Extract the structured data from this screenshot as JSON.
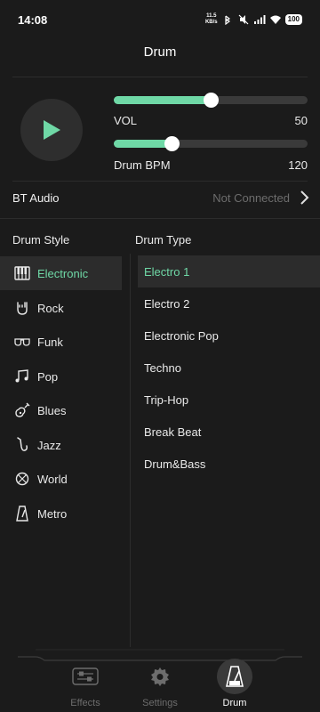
{
  "status": {
    "time": "14:08",
    "net_speed_value": "11.5",
    "net_speed_unit": "KB/s",
    "battery": "100"
  },
  "header": {
    "title": "Drum"
  },
  "player": {
    "vol_label": "VOL",
    "vol_value": "50",
    "vol_fraction": 0.5,
    "bpm_label": "Drum BPM",
    "bpm_value": "120",
    "bpm_fraction": 0.3
  },
  "bt": {
    "label": "BT Audio",
    "status": "Not Connected"
  },
  "drum_style": {
    "heading": "Drum Style",
    "items": [
      {
        "label": "Electronic",
        "icon": "keyboard-icon"
      },
      {
        "label": "Rock",
        "icon": "rock-hand-icon"
      },
      {
        "label": "Funk",
        "icon": "sunglasses-icon"
      },
      {
        "label": "Pop",
        "icon": "music-notes-icon"
      },
      {
        "label": "Blues",
        "icon": "guitar-icon"
      },
      {
        "label": "Jazz",
        "icon": "saxophone-icon"
      },
      {
        "label": "World",
        "icon": "globe-icon"
      },
      {
        "label": "Metro",
        "icon": "metronome-icon"
      }
    ],
    "selected": "Electronic"
  },
  "drum_type": {
    "heading": "Drum Type",
    "items": [
      "Electro 1",
      "Electro 2",
      "Electronic Pop",
      "Techno",
      "Trip-Hop",
      "Break Beat",
      "Drum&Bass"
    ],
    "selected": "Electro 1"
  },
  "nav": {
    "items": [
      {
        "label": "Effects",
        "icon": "effects-icon"
      },
      {
        "label": "Settings",
        "icon": "gear-icon"
      },
      {
        "label": "Drum",
        "icon": "metronome-icon"
      }
    ],
    "active": "Drum"
  },
  "colors": {
    "accent": "#6fd8a6",
    "background": "#1b1b1b",
    "muted": "#6d6d6d"
  }
}
